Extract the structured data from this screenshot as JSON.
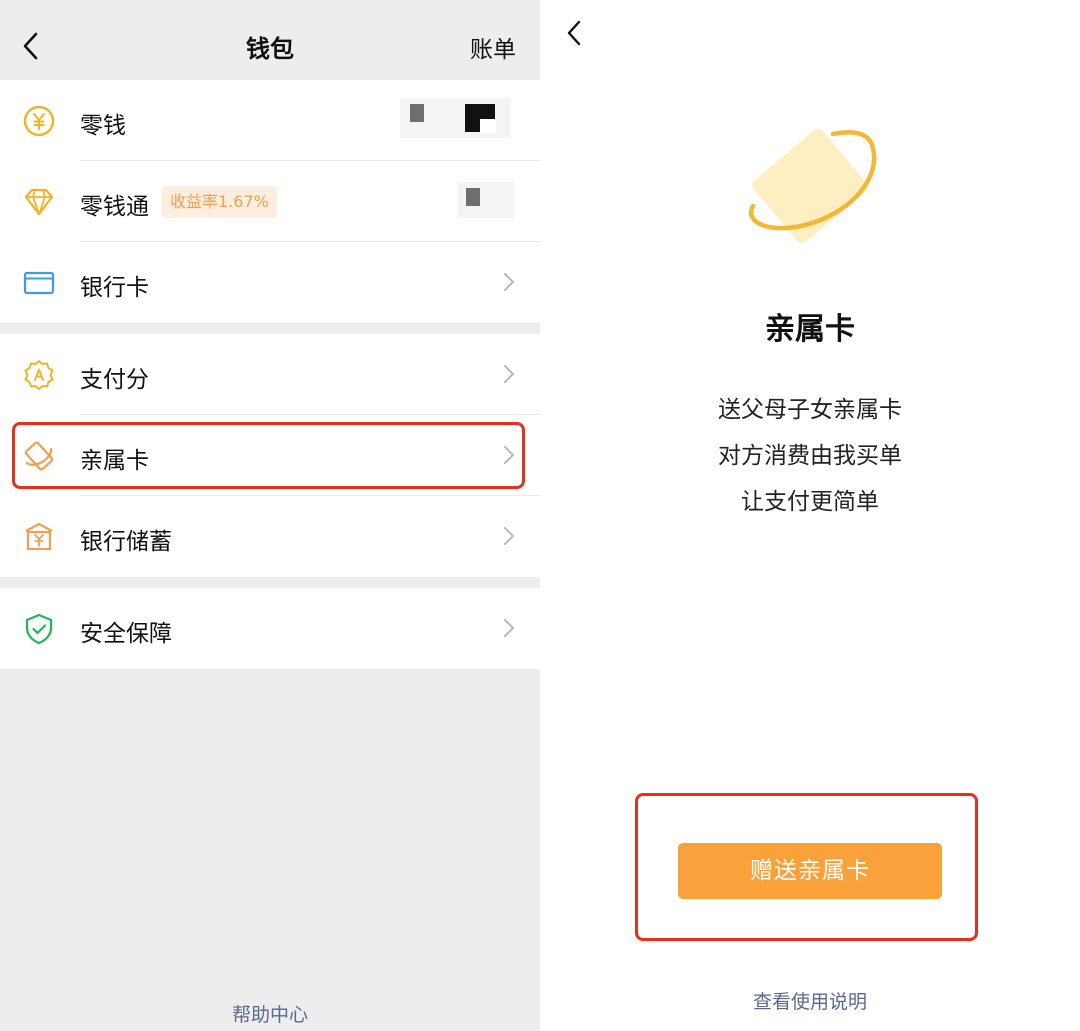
{
  "wallet": {
    "title": "钱包",
    "bill_label": "账单",
    "items": [
      {
        "label": "零钱"
      },
      {
        "label": "零钱通",
        "badge": "收益率1.67%"
      },
      {
        "label": "银行卡"
      },
      {
        "label": "支付分"
      },
      {
        "label": "亲属卡"
      },
      {
        "label": "银行储蓄"
      },
      {
        "label": "安全保障"
      }
    ],
    "help_label": "帮助中心"
  },
  "family_card": {
    "title": "亲属卡",
    "desc_lines": [
      "送父母子女亲属卡",
      "对方消费由我买单",
      "让支付更简单"
    ],
    "button_label": "赠送亲属卡",
    "usage_link": "查看使用说明"
  },
  "colors": {
    "accent_orange": "#f9a13a",
    "highlight_red": "#e2321f",
    "icon_yellow": "#f0b429",
    "icon_blue": "#3d9ae8",
    "icon_green": "#22b35e",
    "link_blue_gray": "#5a6a8a"
  },
  "icons": {
    "change": "yen-coin-icon",
    "lingqiantong": "diamond-icon",
    "bank_card": "bank-card-icon",
    "pay_score": "badge-a-icon",
    "family_card": "family-card-icon",
    "savings": "bank-building-icon",
    "security": "shield-check-icon"
  }
}
